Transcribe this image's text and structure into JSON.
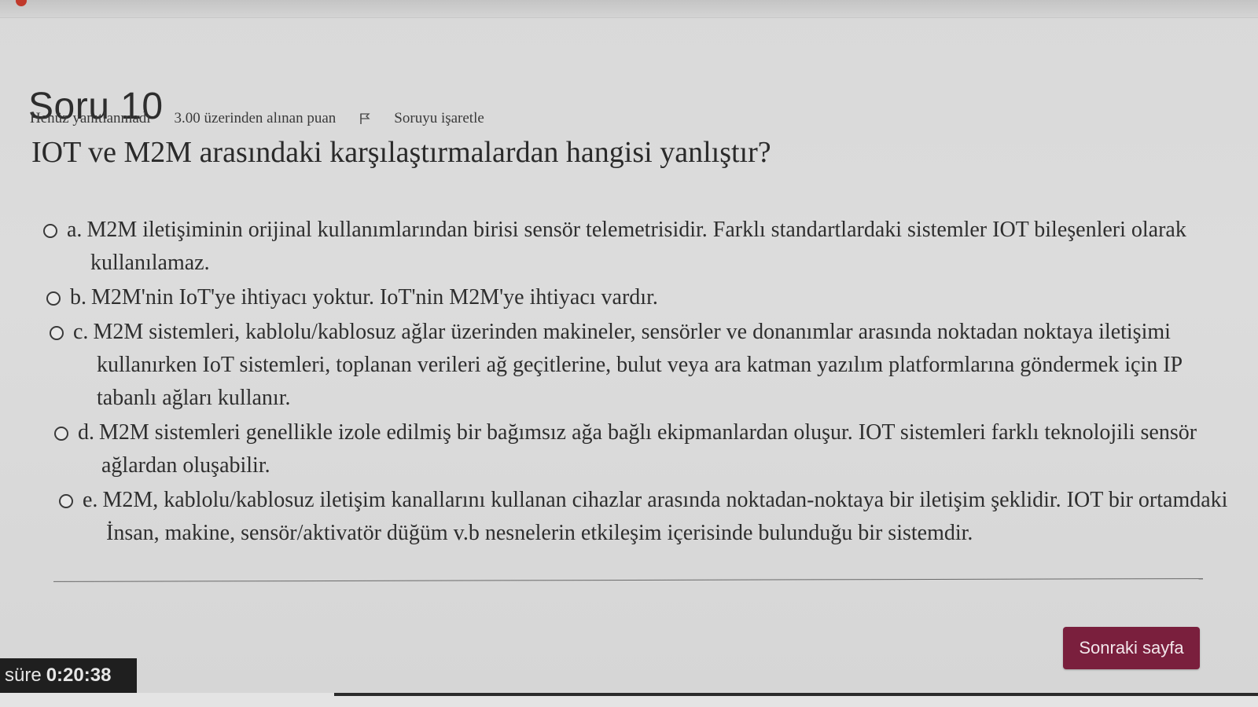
{
  "question": {
    "title": "Soru 10",
    "status": "Henüz yanıtlanmadı",
    "points": "3.00 üzerinden alınan puan",
    "flag_label": "Soruyu işaretle",
    "text": "IOT ve M2M arasındaki karşılaştırmalardan hangisi yanlıştır?"
  },
  "answers": [
    {
      "letter": "a.",
      "text": "M2M iletişiminin orijinal kullanımlarından birisi sensör telemetrisidir. Farklı standartlardaki sistemler IOT bileşenleri olarak kullanılamaz."
    },
    {
      "letter": "b.",
      "text": "M2M'nin IoT'ye ihtiyacı yoktur. IoT'nin M2M'ye ihtiyacı vardır."
    },
    {
      "letter": "c.",
      "text": "M2M sistemleri, kablolu/kablosuz ağlar üzerinden makineler, sensörler ve donanımlar arasında noktadan noktaya iletişimi kullanırken IoT sistemleri, toplanan verileri ağ geçitlerine, bulut veya ara katman yazılım platformlarına göndermek için IP tabanlı ağları kullanır."
    },
    {
      "letter": "d.",
      "text": "M2M sistemleri genellikle izole edilmiş bir bağımsız ağa bağlı ekipmanlardan oluşur. IOT sistemleri farklı teknolojili sensör ağlardan oluşabilir."
    },
    {
      "letter": "e.",
      "text": "M2M, kablolu/kablosuz iletişim kanallarını kullanan cihazlar arasında noktadan-noktaya bir iletişim şeklidir. IOT bir ortamdaki İnsan, makine, sensör/aktivatör düğüm v.b nesnelerin etkileşim içerisinde bulunduğu bir sistemdir."
    }
  ],
  "navigation": {
    "next_label": "Sonraki sayfa"
  },
  "timer": {
    "label": "süre",
    "value": "0:20:38"
  },
  "colors": {
    "accent": "#7a1f3d",
    "timer_bg": "#1f1f1f"
  }
}
